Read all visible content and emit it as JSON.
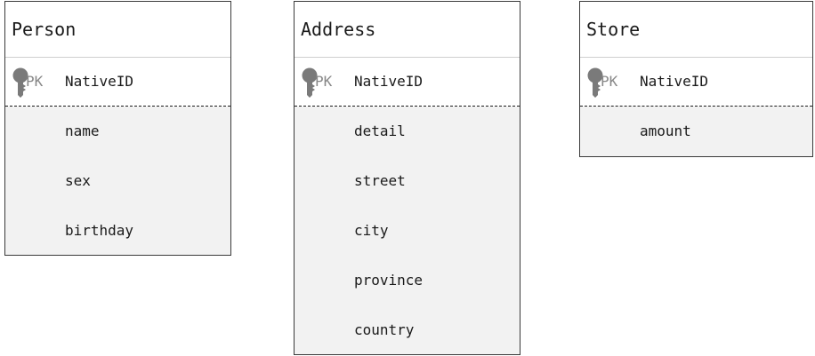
{
  "entities": [
    {
      "title": "Person",
      "pk": {
        "label": "PK",
        "name": "NativeID"
      },
      "fields": [
        "name",
        "sex",
        "birthday"
      ]
    },
    {
      "title": "Address",
      "pk": {
        "label": "PK",
        "name": "NativeID"
      },
      "fields": [
        "detail",
        "street",
        "city",
        "province",
        "country"
      ]
    },
    {
      "title": "Store",
      "pk": {
        "label": "PK",
        "name": "NativeID"
      },
      "fields": [
        "amount"
      ]
    }
  ],
  "icons": {
    "primary_key": "key-icon"
  },
  "colors": {
    "field_background": "#f2f2f2",
    "pk_label": "#888888",
    "key_icon": "#7a7a7a"
  }
}
